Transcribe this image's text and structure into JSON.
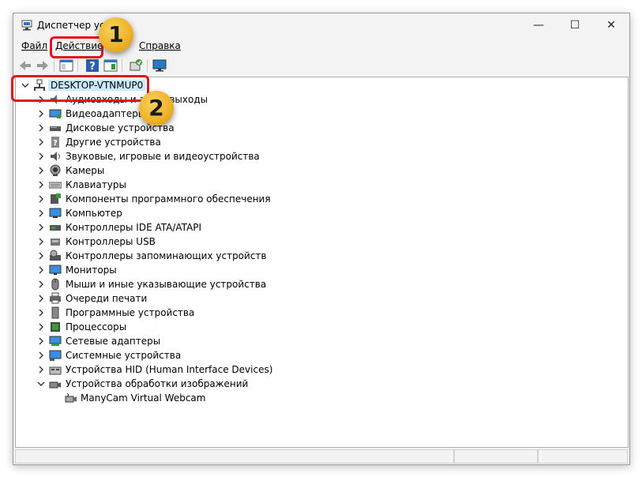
{
  "window": {
    "title": "Диспетчер уст"
  },
  "titlebar_controls": {
    "minimize": "—",
    "maximize": "☐",
    "close": "✕"
  },
  "menu": {
    "items": [
      "Файл",
      "Действие",
      "Справка"
    ]
  },
  "tree": {
    "root": "DESKTOP-VTNMUP0",
    "categories": [
      "Аудиовходы и аудиовыходы",
      "Видеоадаптеры",
      "Дисковые устройства",
      "Другие устройства",
      "Звуковые, игровые и видеоустройства",
      "Камеры",
      "Клавиатуры",
      "Компоненты программного обеспечения",
      "Компьютер",
      "Контроллеры IDE ATA/ATAPI",
      "Контроллеры USB",
      "Контроллеры запоминающих устройств",
      "Мониторы",
      "Мыши и иные указывающие устройства",
      "Очереди печати",
      "Программные устройства",
      "Процессоры",
      "Сетевые адаптеры",
      "Системные устройства",
      "Устройства HID (Human Interface Devices)",
      "Устройства обработки изображений"
    ],
    "expanded_child": "ManyCam Virtual Webcam"
  },
  "annotations": {
    "badge_1": "1",
    "badge_2": "2",
    "highlight_color": "#e0141e",
    "badge_color": "#f0b429"
  }
}
